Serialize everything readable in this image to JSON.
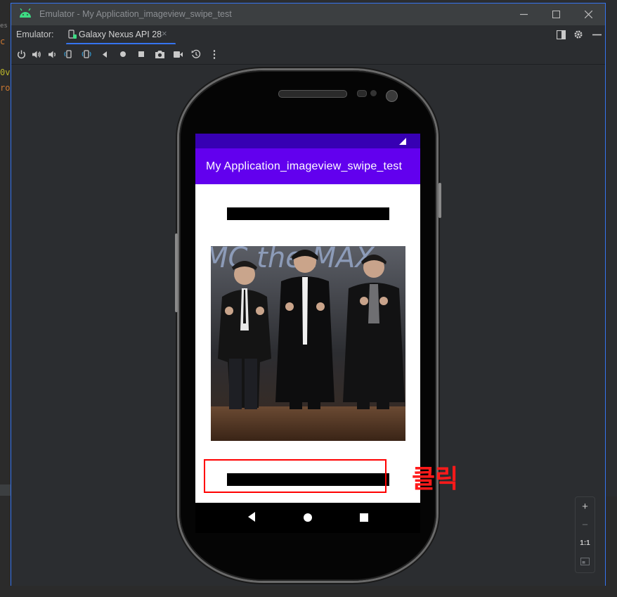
{
  "ide": {
    "code_fragments": [
      "es",
      "c",
      "0v",
      "ro"
    ]
  },
  "window": {
    "title": "Emulator - My Application_imageview_swipe_test",
    "controls": {
      "minimize": "—",
      "maximize": "☐",
      "close": "✕"
    }
  },
  "tabs": {
    "emulator_label": "Emulator:",
    "active_tab": "Galaxy Nexus API 28",
    "close_glyph": "×"
  },
  "toolbar": {
    "buttons": [
      "power-icon",
      "volume-up-icon",
      "volume-down-icon",
      "rotate-left-icon",
      "rotate-right-icon",
      "back-icon",
      "home-icon",
      "overview-icon",
      "camera-icon",
      "screenrecord-icon",
      "snapshot-icon",
      "more-icon"
    ],
    "more_glyph": "⋮"
  },
  "device": {
    "app_title": "My Application_imageview_swipe_test",
    "colors": {
      "status_bar": "#3700b3",
      "app_bar": "#6200ee"
    },
    "photo_caption_text": "MC the MAX"
  },
  "annotation": {
    "label": "클릭",
    "color": "#ff0000"
  },
  "zoom": {
    "zoom_in": "+",
    "zoom_out": "−",
    "one_to_one": "1:1"
  }
}
